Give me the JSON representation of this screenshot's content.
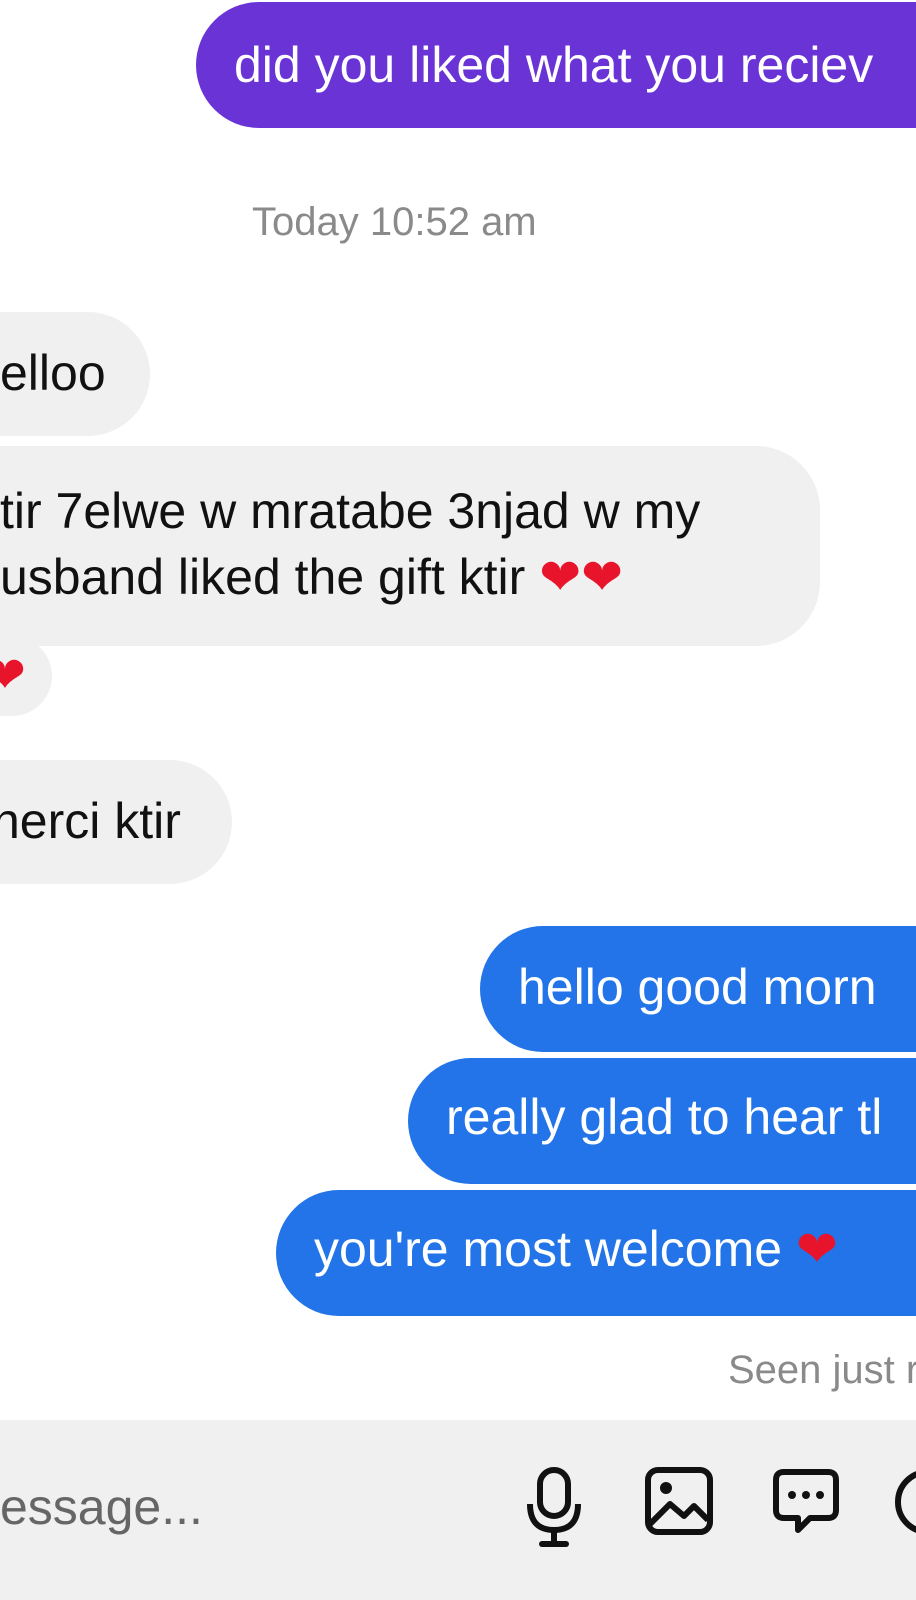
{
  "thread": {
    "outgoing_top": "did you liked what you reciev",
    "timestamp": "Today 10:52 am",
    "incoming": [
      "elloo",
      "tir 7elwe w mratabe 3njad w my",
      "usband liked the gift ktir",
      "❤",
      "nerci ktir"
    ],
    "incoming_line2_hearts": "❤❤",
    "outgoing_replies": [
      "hello good morn",
      "really glad to hear tl",
      "you're most welcome"
    ],
    "reply_heart": "❤",
    "seen_status": "Seen just r"
  },
  "composer": {
    "placeholder": "essage...",
    "tools": [
      "microphone-icon",
      "image-icon",
      "chat-options-icon",
      "more-icon"
    ]
  },
  "colors": {
    "outgoing_purple": "#6a33d6",
    "outgoing_blue": "#2274e8",
    "incoming_bg": "#f0f0f0",
    "heart": "#e8142b"
  }
}
